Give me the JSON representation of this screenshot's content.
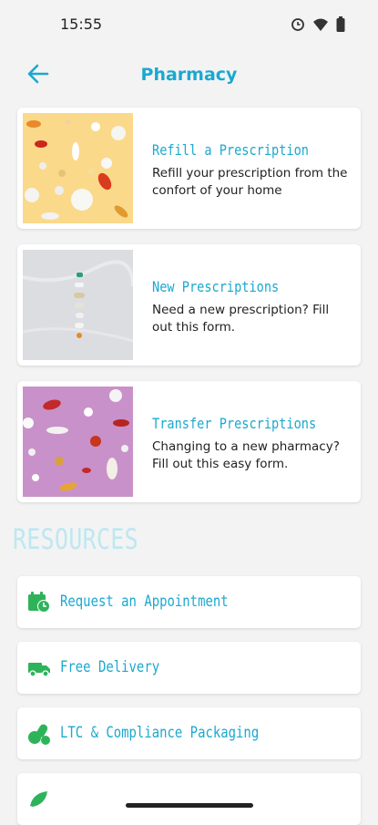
{
  "status": {
    "time": "15:55"
  },
  "header": {
    "title": "Pharmacy"
  },
  "cards": [
    {
      "title": "Refill a Prescription",
      "desc": "Refill your prescription from the confort of your home"
    },
    {
      "title": "New Prescriptions",
      "desc": "Need a new prescription? Fill out this form."
    },
    {
      "title": "Transfer Prescriptions",
      "desc": "Changing to a new pharmacy? Fill out this easy form."
    }
  ],
  "resources": {
    "title": "RESOURCES",
    "items": [
      {
        "label": "Request an Appointment",
        "icon": "calendar-clock-icon"
      },
      {
        "label": "Free Delivery",
        "icon": "truck-icon"
      },
      {
        "label": "LTC & Compliance Packaging",
        "icon": "pills-icon"
      },
      {
        "label": "",
        "icon": "leaf-icon"
      }
    ]
  },
  "colors": {
    "accent": "#1ba8cf",
    "icon_green": "#2fb35a",
    "resources_title": "#bde7f2",
    "background": "#f3f3f3"
  }
}
